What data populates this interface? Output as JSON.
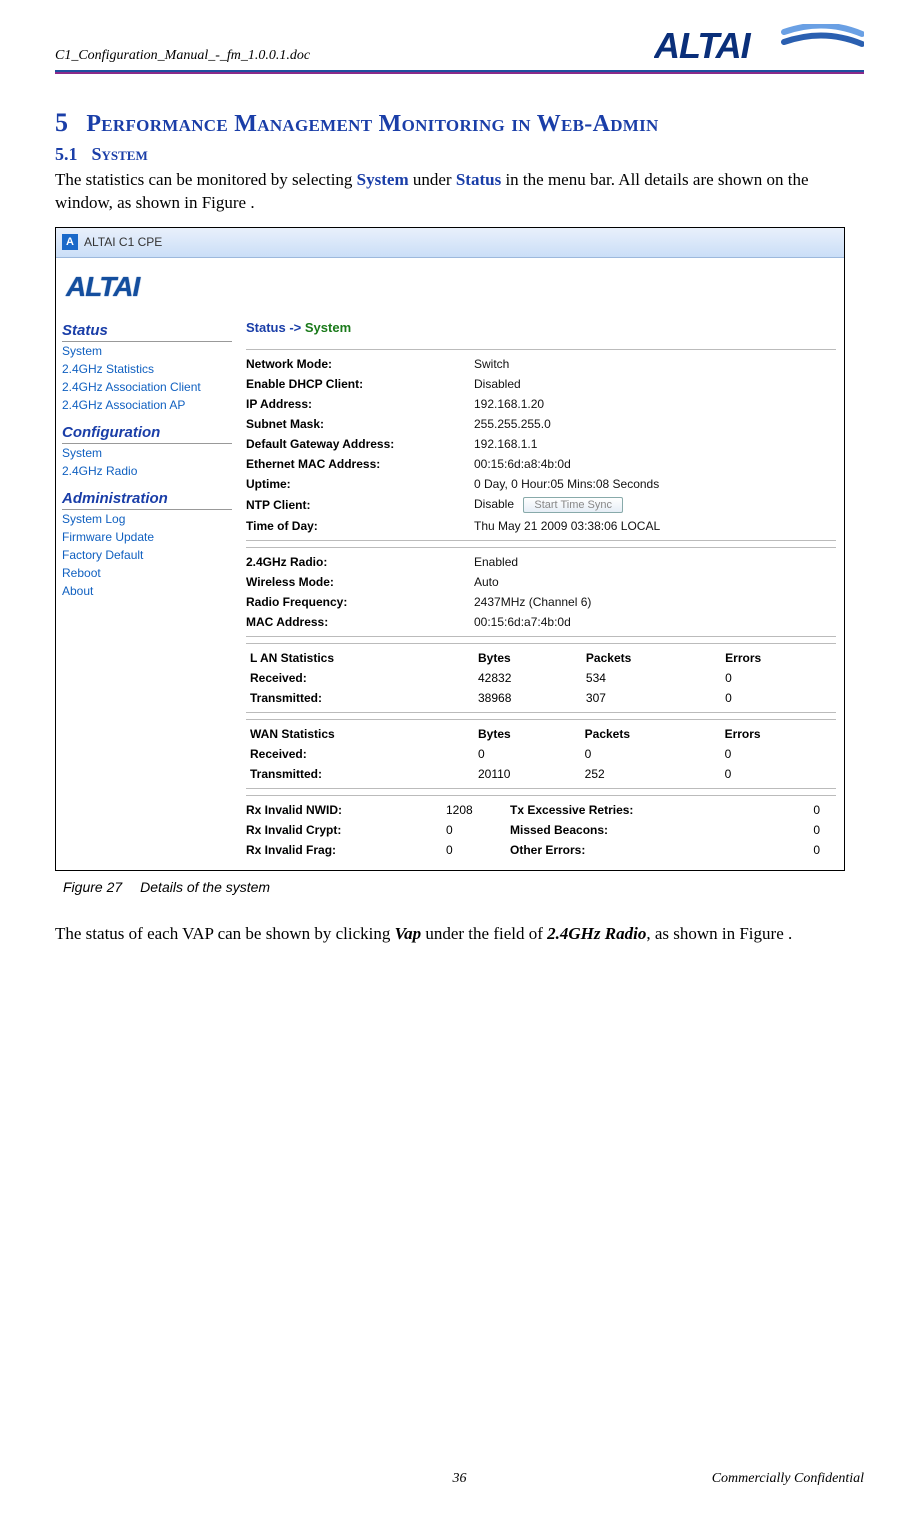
{
  "header": {
    "doc_name": "C1_Configuration_Manual_-_fm_1.0.0.1.doc",
    "brand": "ALTAI"
  },
  "section": {
    "number": "5",
    "title": "Performance Management Monitoring in Web-Admin",
    "sub_number": "5.1",
    "sub_title": "System"
  },
  "paragraphs": {
    "p1_a": "The statistics can be monitored by selecting ",
    "p1_b": "System",
    "p1_c": " under ",
    "p1_d": "Status",
    "p1_e": " in the menu bar. All details are shown on the window, as shown in Figure .",
    "p2_a": "The status of each VAP can be shown by clicking ",
    "p2_b": "Vap",
    "p2_c": " under the field of ",
    "p2_d": "2.4GHz Radio",
    "p2_e": ", as shown in Figure ."
  },
  "figure_caption": {
    "num": "Figure 27",
    "text": "Details of the system"
  },
  "screenshot": {
    "tab_title": "ALTAI C1 CPE",
    "logo_text": "ALTAI",
    "breadcrumb": {
      "b1": "Status ->",
      "b2": "System"
    },
    "sidebar": {
      "groups": [
        {
          "head": "Status",
          "items": [
            "System",
            "2.4GHz Statistics",
            "2.4GHz Association Client",
            "2.4GHz Association AP"
          ]
        },
        {
          "head": "Configuration",
          "items": [
            "System",
            "2.4GHz Radio"
          ]
        },
        {
          "head": "Administration",
          "items": [
            "System Log",
            "Firmware Update",
            "Factory Default",
            "Reboot",
            "About"
          ]
        }
      ]
    },
    "sys_info": [
      {
        "k": "Network Mode:",
        "v": "Switch"
      },
      {
        "k": "Enable DHCP Client:",
        "v": "Disabled"
      },
      {
        "k": "IP Address:",
        "v": "192.168.1.20"
      },
      {
        "k": "Subnet Mask:",
        "v": "255.255.255.0"
      },
      {
        "k": "Default Gateway Address:",
        "v": "192.168.1.1"
      },
      {
        "k": "Ethernet MAC Address:",
        "v": "00:15:6d:a8:4b:0d"
      },
      {
        "k": "Uptime:",
        "v": "0 Day, 0 Hour:05 Mins:08 Seconds"
      },
      {
        "k": "NTP Client:",
        "v": "Disable",
        "btn": "Start Time Sync"
      },
      {
        "k": "Time of Day:",
        "v": "Thu May 21 2009 03:38:06 LOCAL"
      }
    ],
    "radio_info": [
      {
        "k": "2.4GHz Radio:",
        "v": "Enabled"
      },
      {
        "k": "Wireless Mode:",
        "v": "Auto"
      },
      {
        "k": "Radio Frequency:",
        "v": "2437MHz (Channel 6)"
      },
      {
        "k": "MAC Address:",
        "v": "00:15:6d:a7:4b:0d"
      }
    ],
    "lan_stats": {
      "title": "L AN Statistics",
      "cols": [
        "Bytes",
        "Packets",
        "Errors"
      ],
      "rows": [
        {
          "k": "Received:",
          "v": [
            "42832",
            "534",
            "0"
          ]
        },
        {
          "k": "Transmitted:",
          "v": [
            "38968",
            "307",
            "0"
          ]
        }
      ]
    },
    "wan_stats": {
      "title": "WAN Statistics",
      "cols": [
        "Bytes",
        "Packets",
        "Errors"
      ],
      "rows": [
        {
          "k": "Received:",
          "v": [
            "0",
            "0",
            "0"
          ]
        },
        {
          "k": "Transmitted:",
          "v": [
            "20110",
            "252",
            "0"
          ]
        }
      ]
    },
    "err_stats": [
      {
        "k1": "Rx Invalid NWID:",
        "v1": "1208",
        "k2": "Tx Excessive Retries:",
        "v2": "0"
      },
      {
        "k1": "Rx Invalid Crypt:",
        "v1": "0",
        "k2": "Missed Beacons:",
        "v2": "0"
      },
      {
        "k1": "Rx Invalid Frag:",
        "v1": "0",
        "k2": "Other Errors:",
        "v2": "0"
      }
    ]
  },
  "footer": {
    "page_number": "36",
    "confidential": "Commercially Confidential"
  }
}
